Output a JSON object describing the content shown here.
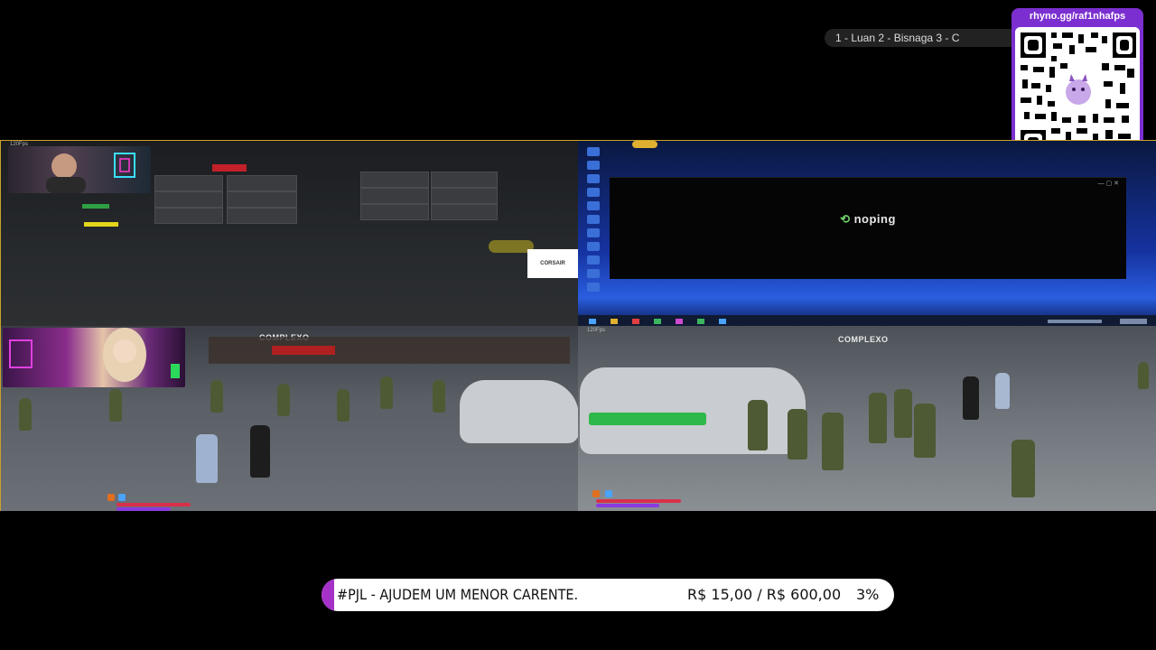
{
  "overlay": {
    "ticker_text": "1 - Luan 2 - Bisnaga 3 - C",
    "qr_url": "rhyno.gg/raf1nhafps"
  },
  "panes": {
    "top_left": {
      "fps": "120Fps",
      "corsair_label": "CORSAIR"
    },
    "top_right": {
      "noping_brand": "noping"
    },
    "bottom_left": {
      "fps": "120Fps",
      "watermark": "COMPLEXO"
    },
    "bottom_right": {
      "fps": "120Fps",
      "watermark": "COMPLEXO"
    }
  },
  "donation": {
    "tag": "#PJL - AJUDEM UM MENOR CARENTE.",
    "amount": "R$ 15,00 / R$ 600,00",
    "percent": "3%",
    "progress": 0.03,
    "accent_color": "#a531c9"
  }
}
